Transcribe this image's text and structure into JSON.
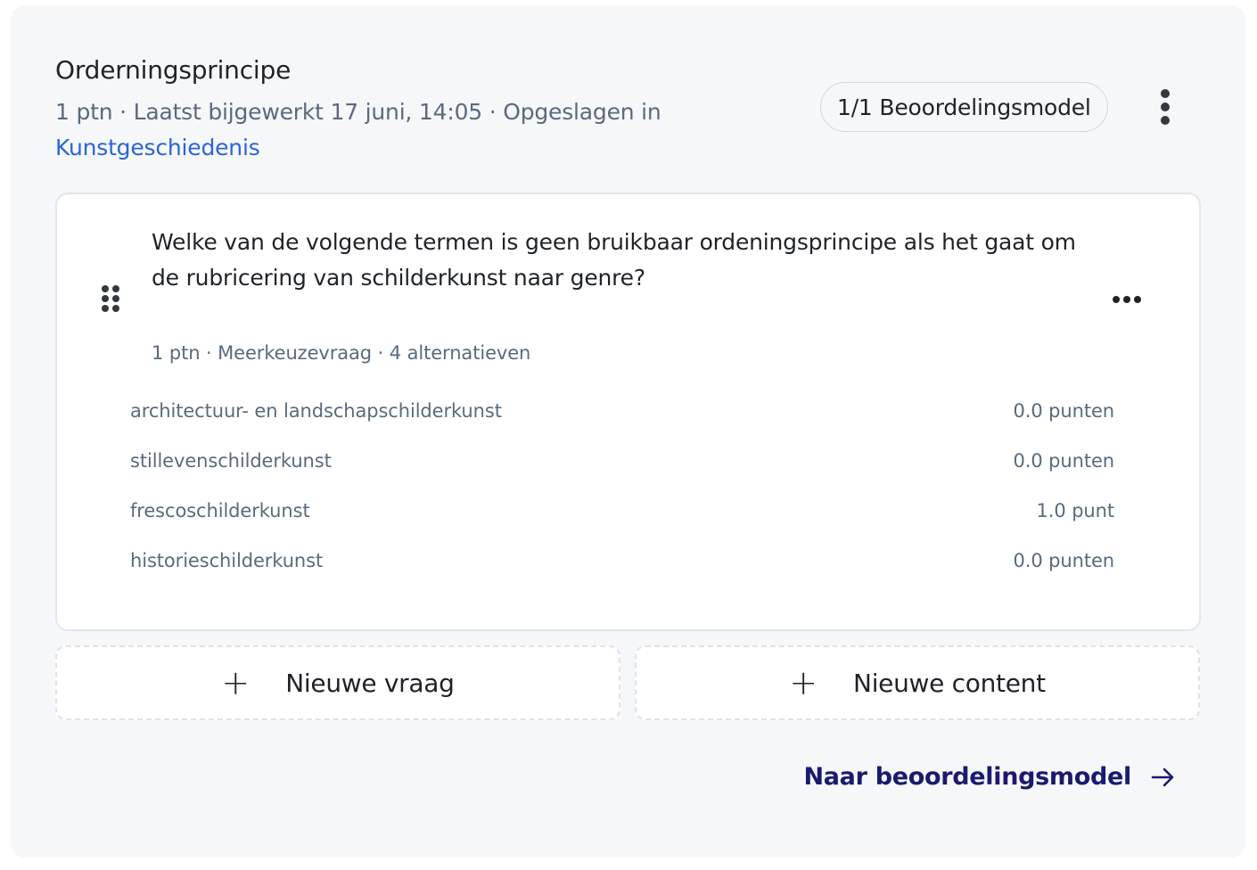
{
  "header": {
    "title": "Orderningsprincipe",
    "meta_text": "1 ptn · Laatst bijgewerkt 17 juni, 14:05 · Opgeslagen in",
    "folder_link": "Kunstgeschiedenis",
    "rubric_badge": "1/1 Beoordelingsmodel",
    "more_icon": "vertical-dots-icon"
  },
  "question": {
    "text": "Welke van de volgende termen is geen bruikbaar ordeningsprincipe als het gaat om de rubricering van schilderkunst naar genre?",
    "meta": "1 ptn · Meerkeuzevraag · 4 alternatieven",
    "drag_icon": "drag-handle-icon",
    "menu_icon": "horizontal-dots-icon",
    "alternatives": [
      {
        "label": "architectuur- en landschapschilderkunst",
        "points": "0.0 punten"
      },
      {
        "label": "stillevenschilderkunst",
        "points": "0.0 punten"
      },
      {
        "label": "frescoschilderkunst",
        "points": "1.0 punt"
      },
      {
        "label": "historieschilderkunst",
        "points": "0.0 punten"
      }
    ]
  },
  "actions": {
    "new_question": "Nieuwe vraag",
    "new_content": "Nieuwe content",
    "plus_symbol": "+",
    "to_rubric": "Naar beoordelingsmodel",
    "arrow_icon": "arrow-right-icon"
  },
  "colors": {
    "background": "#f6f7f9",
    "link": "#2a65d6",
    "primary_link": "#1a1a6e",
    "muted_text": "#5a6a7e"
  }
}
